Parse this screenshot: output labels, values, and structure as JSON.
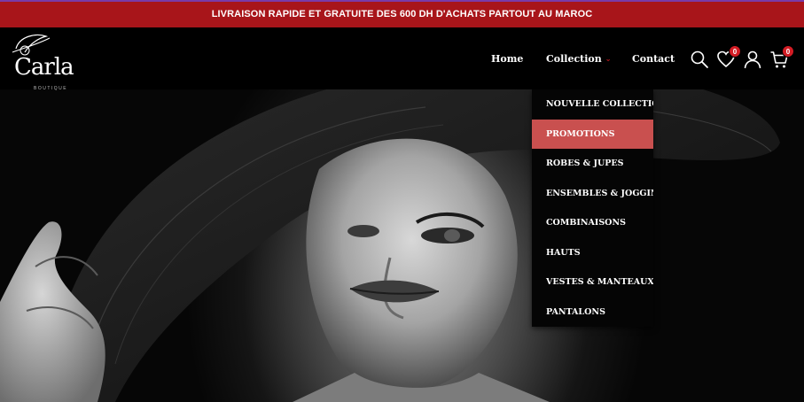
{
  "announcement": "LIVRAISON RAPIDE ET GRATUITE DES 600 DH D'ACHATS PARTOUT AU MAROC",
  "logo": {
    "name": "Carla",
    "tagline": "BOUTIQUE"
  },
  "nav": {
    "home": "Home",
    "collection": "Collection",
    "contact": "Contact"
  },
  "icons": {
    "search": "search-icon",
    "wishlist": "heart-icon",
    "account": "user-icon",
    "cart": "cart-icon"
  },
  "counts": {
    "wishlist": "0",
    "cart": "0"
  },
  "dropdown": {
    "items": [
      "NOUVELLE COLLECTION",
      "PROMOTIONS",
      "ROBES & JUPES",
      "ENSEMBLES & JOGGINGS",
      "COMBINAISONS",
      "HAUTS",
      "VESTES & MANTEAUX",
      "PANTALONS"
    ],
    "active_index": 1
  },
  "colors": {
    "announcement_bg": "#a8151a",
    "badge": "#d31c24",
    "dropdown_active": "#c9504f",
    "chevron": "#a8151a"
  }
}
